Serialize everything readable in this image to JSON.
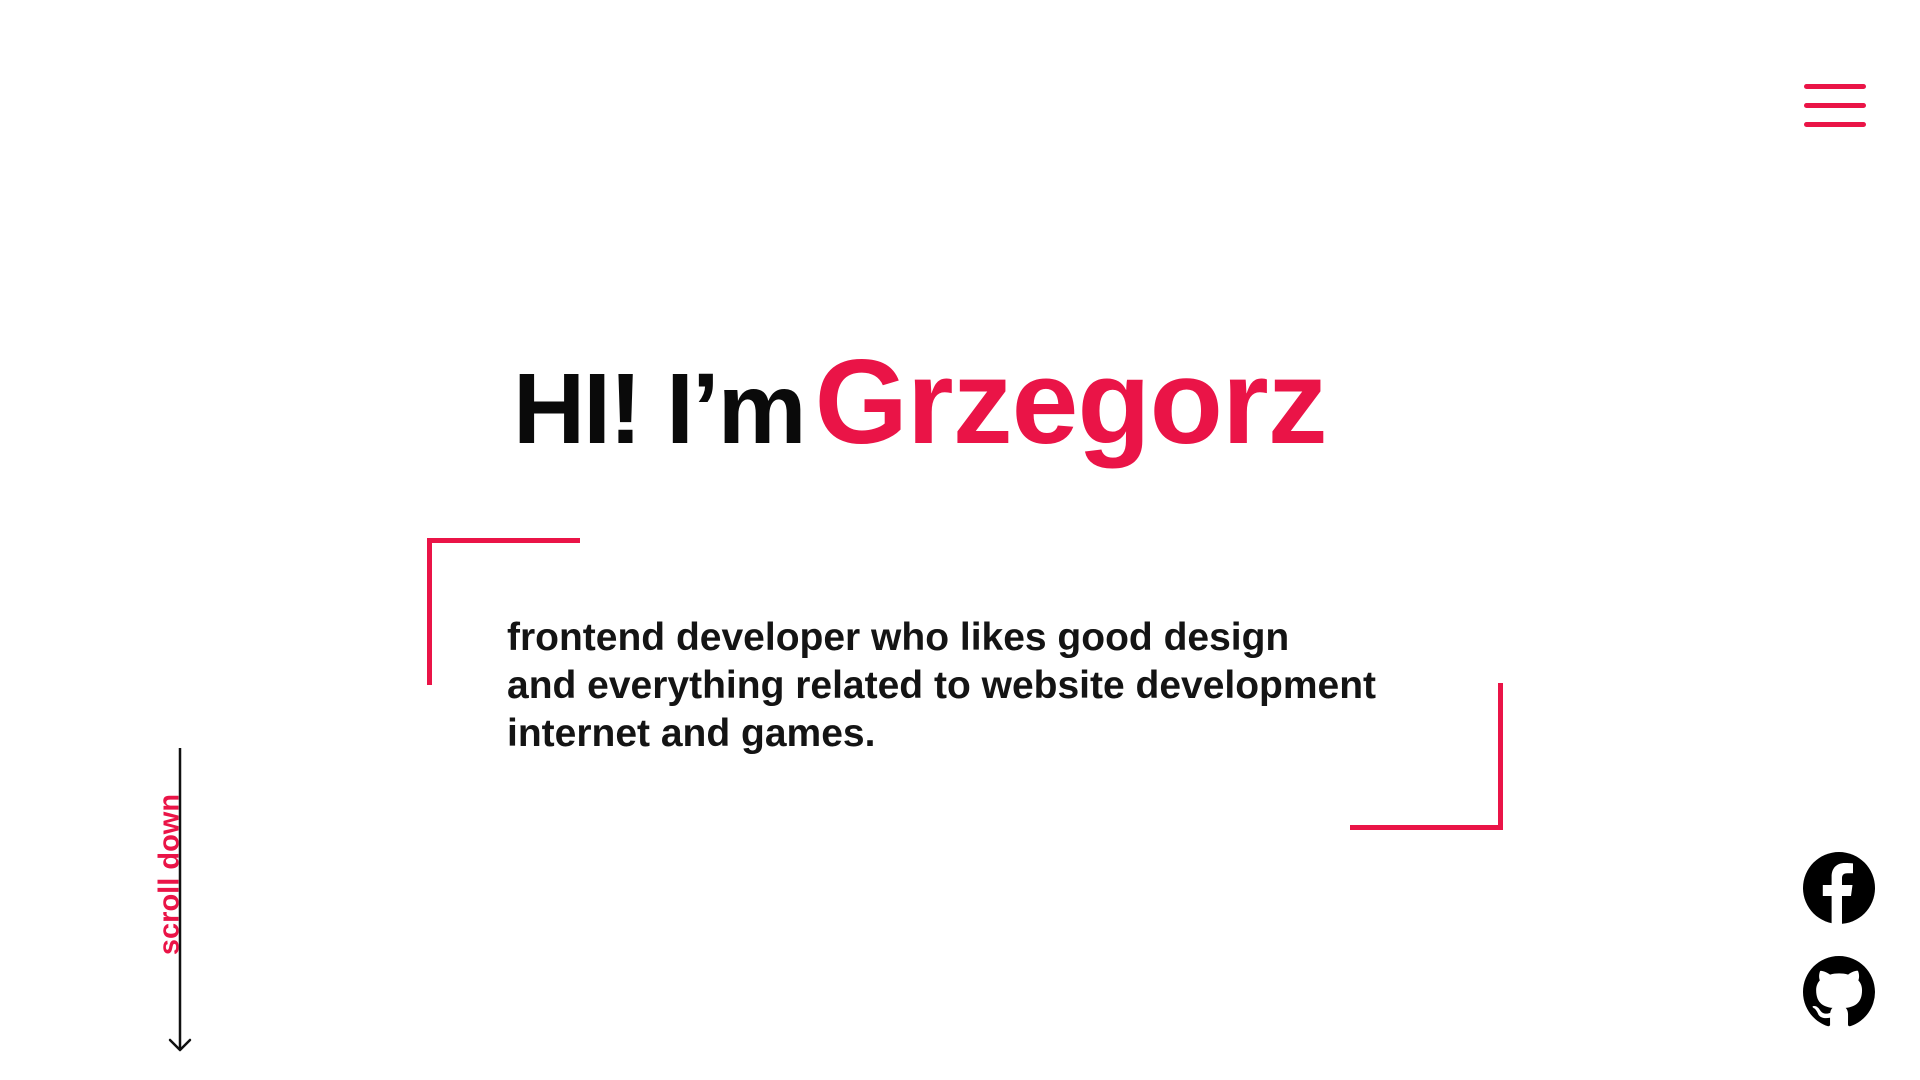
{
  "nav": {
    "menu_icon": "hamburger-icon",
    "accent_color": "#ea1447"
  },
  "hero": {
    "greeting": "HI! I’m",
    "name": "Grzegorz",
    "description_lines": [
      "frontend developer who likes good design",
      "and everything related to website development",
      "internet and games."
    ]
  },
  "scroll": {
    "label": "scroll down",
    "icon": "arrow-down-icon"
  },
  "social": [
    {
      "name": "Facebook",
      "icon": "facebook-icon"
    },
    {
      "name": "GitHub",
      "icon": "github-icon"
    }
  ],
  "colors": {
    "accent": "#ea1447",
    "text": "#0a0a0a",
    "background": "#ffffff"
  }
}
